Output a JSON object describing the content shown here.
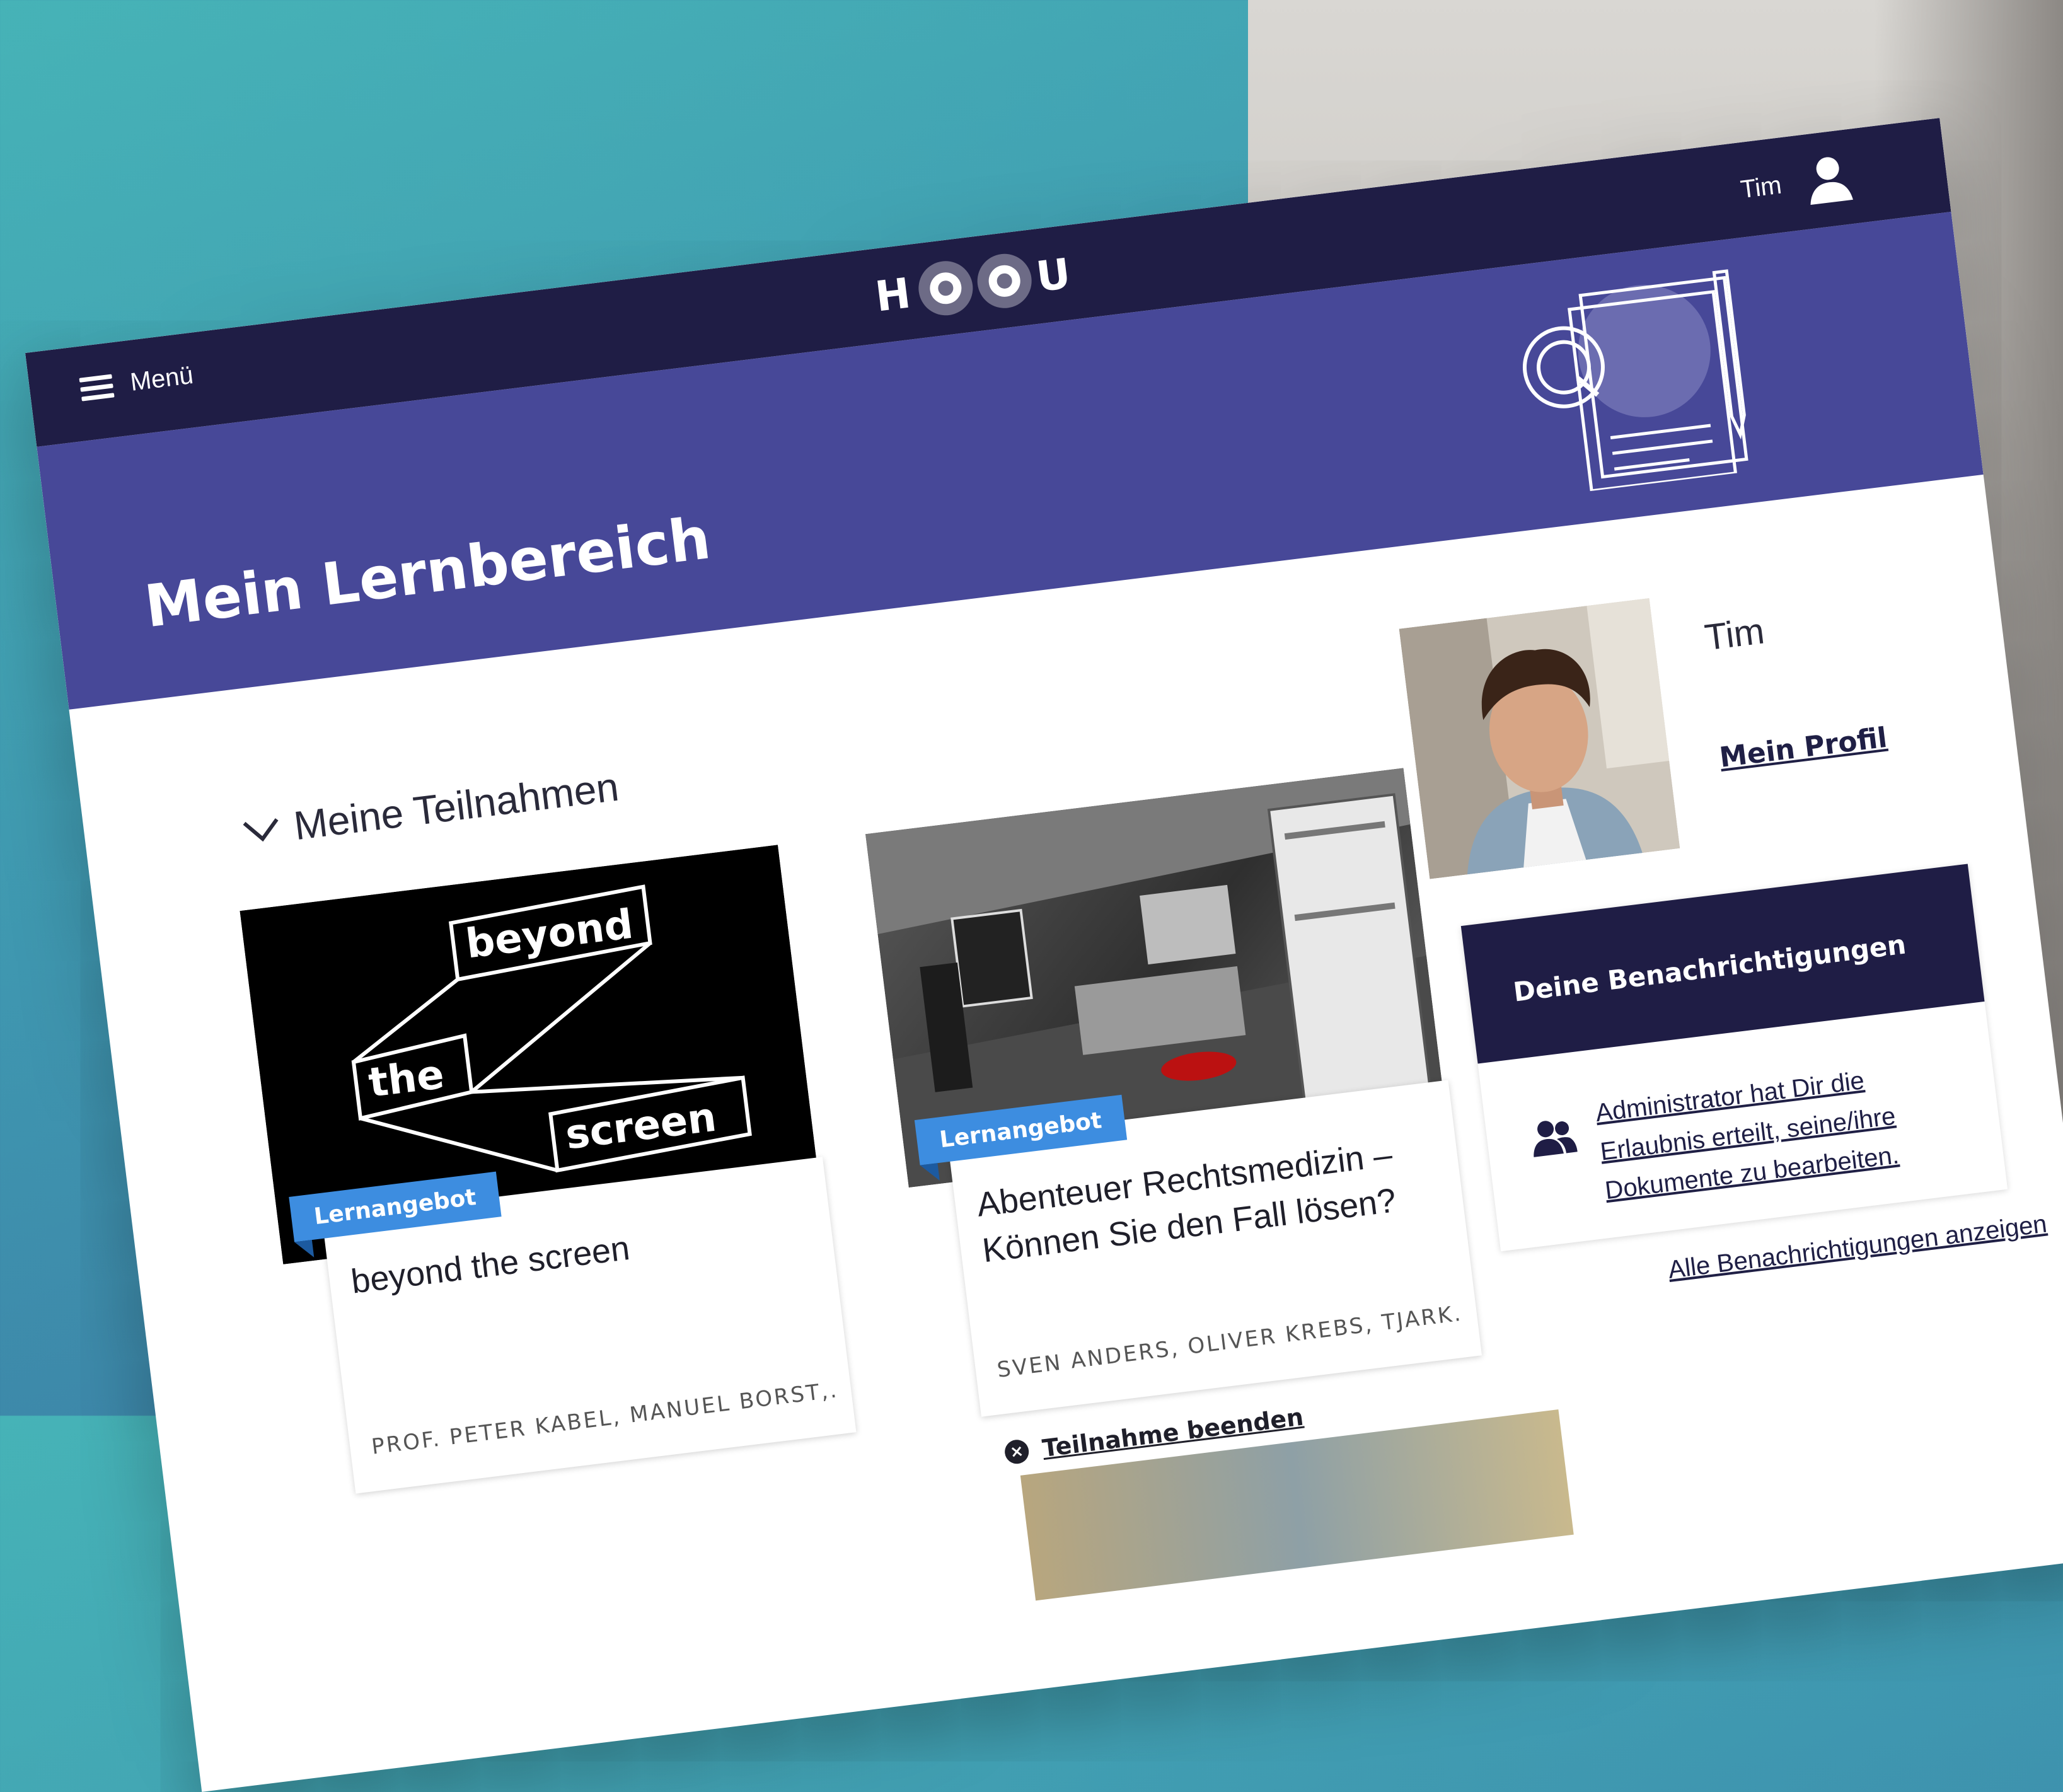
{
  "app": {
    "logo_text": "HOOU",
    "accent_color": "#474898",
    "navy_color": "#1f1d45",
    "tag_color": "#3d8de0"
  },
  "header": {
    "menu_label": "Menü",
    "menu_icon": "hamburger-icon",
    "user_name": "Tim",
    "user_icon": "user-icon"
  },
  "page": {
    "title": "Mein Lernbereich"
  },
  "participations": {
    "section_title": "Meine Teilnahmen",
    "cards": [
      {
        "tag": "Lernangebot",
        "title": "beyond the screen",
        "authors": "PROF. PETER KABEL, MANUEL BORST,...",
        "image_words": [
          "beyond",
          "the",
          "screen"
        ]
      },
      {
        "tag": "Lernangebot",
        "title": "Abenteuer Rechtsmedizin – Können Sie den Fall lösen?",
        "authors": "SVEN ANDERS, OLIVER KREBS, TJARK...",
        "end_label": "Teilnahme beenden"
      }
    ]
  },
  "profile": {
    "name": "Tim",
    "link_label": "Mein Profil"
  },
  "notifications": {
    "title": "Deine Benachrichtigungen",
    "items": [
      {
        "icon": "people-icon",
        "text": "Administrator hat Dir die Erlaubnis erteilt, seine/ihre Dokumente zu bearbeiten."
      }
    ],
    "all_label": "Alle Benachrichtigungen anzeigen"
  }
}
